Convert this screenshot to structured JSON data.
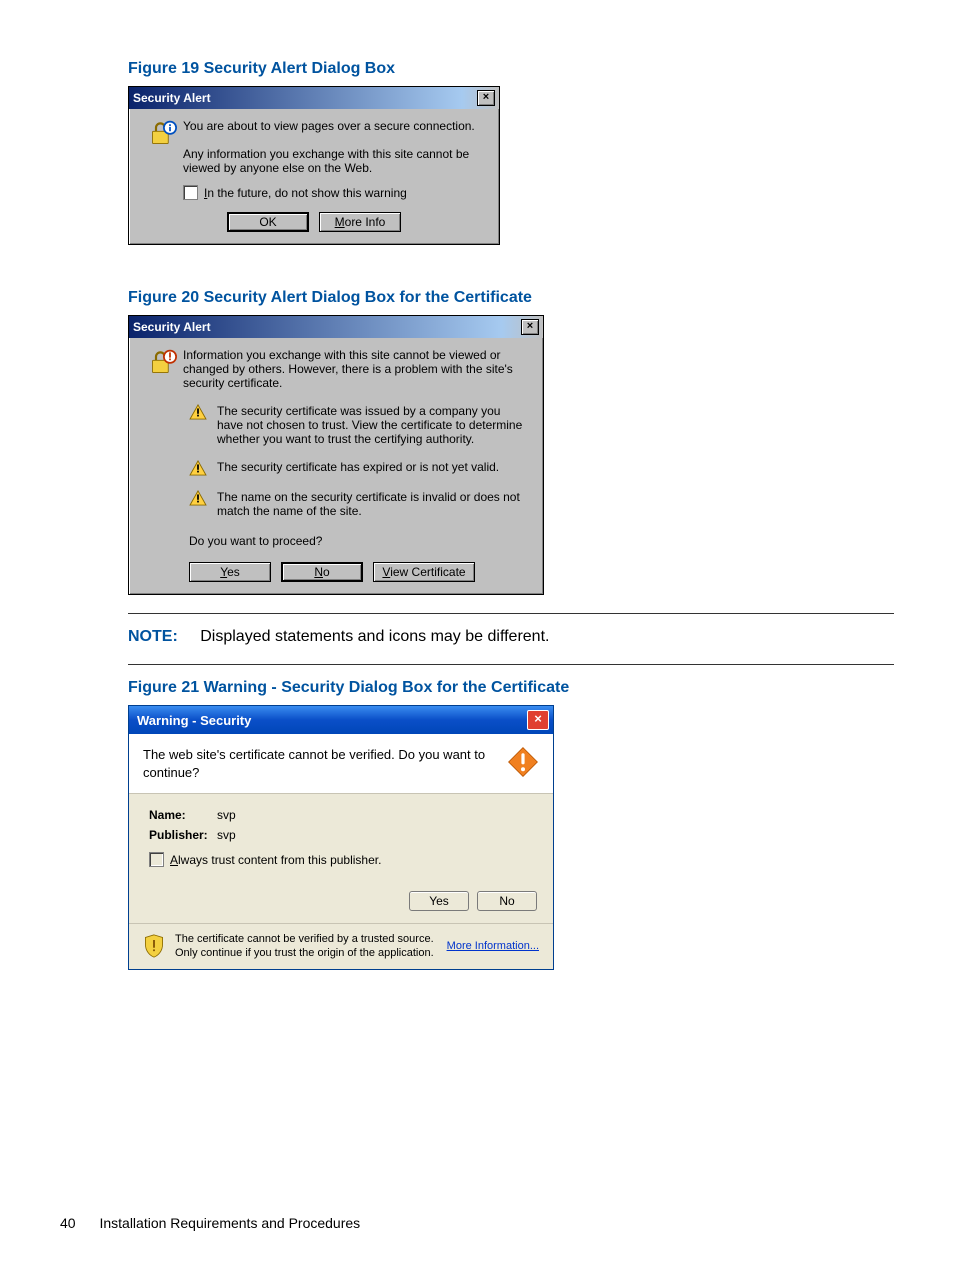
{
  "captions": {
    "fig19": "Figure 19 Security Alert Dialog Box",
    "fig20": "Figure 20 Security Alert Dialog Box for the Certificate",
    "fig21": "Figure 21 Warning - Security Dialog Box for the Certificate"
  },
  "note": {
    "label": "NOTE:",
    "text": "Displayed statements and icons may be different."
  },
  "dialog1": {
    "title": "Security Alert",
    "line1": "You are about to view pages over a secure connection.",
    "line2": "Any information you exchange with this site cannot be viewed by anyone else on the Web.",
    "checkbox": "In the future, do not show this warning",
    "ok": "OK",
    "moreinfo": "More Info"
  },
  "dialog2": {
    "title": "Security Alert",
    "intro": "Information you exchange with this site cannot be viewed or changed by others. However, there is a problem with the site's security certificate.",
    "item1": "The security certificate was issued by a company you have not chosen to trust. View the certificate to determine whether you want to trust the certifying authority.",
    "item2": "The security certificate has expired or is not yet valid.",
    "item3": "The name on the security certificate is invalid or does not match the name of the site.",
    "proceed": "Do you want to proceed?",
    "yes": "Yes",
    "no": "No",
    "viewcert": "View Certificate"
  },
  "dialog3": {
    "title": "Warning - Security",
    "msg": "The web site's certificate cannot be verified.  Do you want to continue?",
    "name_label": "Name:",
    "name_value": "svp",
    "publisher_label": "Publisher:",
    "publisher_value": "svp",
    "checkbox": "Always trust content from this publisher.",
    "yes": "Yes",
    "no": "No",
    "footer": "The certificate cannot be verified by a trusted source.  Only continue if you trust the origin of the application.",
    "more": "More Information..."
  },
  "footer": {
    "page": "40",
    "section": "Installation Requirements and Procedures"
  }
}
